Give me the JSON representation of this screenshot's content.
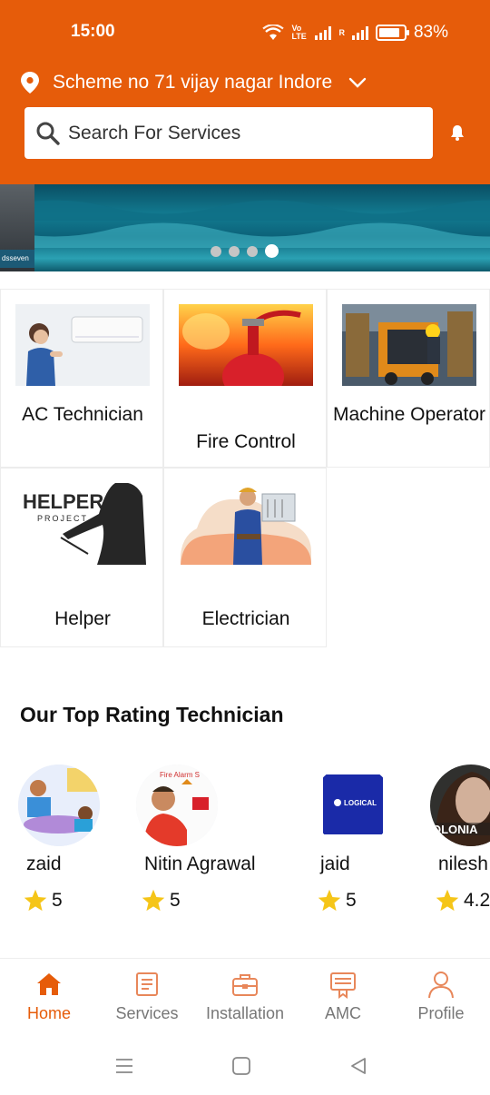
{
  "status_bar": {
    "time": "15:00",
    "battery": "83%",
    "battery_level": 0.83,
    "volte": "Vo LTE",
    "net": "R"
  },
  "header": {
    "location": "Scheme no 71 vijay nagar Indore",
    "search_placeholder": "Search For Services",
    "accent_color": "#E65C0A"
  },
  "banner": {
    "side_label": "dsseven",
    "slide_count": 4,
    "active_slide": 4
  },
  "services": [
    {
      "label": "AC Technician"
    },
    {
      "label": "Fire Control"
    },
    {
      "label": "Machine Operator"
    },
    {
      "label": "Helper"
    },
    {
      "label": "Electrician"
    }
  ],
  "helper_logo_text": {
    "line1": "HELPER",
    "line2": "PROJECT"
  },
  "top_rating": {
    "title": "Our Top Rating Technician",
    "technicians": [
      {
        "name": "zaid",
        "rating": "5"
      },
      {
        "name": "Nitin Agrawal",
        "rating": "5",
        "avatar_text": "Fire Alarm S"
      },
      {
        "name": "jaid",
        "rating": "5",
        "avatar_text": "LOGICAL"
      },
      {
        "name": "nilesh",
        "rating": "4.2",
        "avatar_text": "OLONIA"
      }
    ]
  },
  "bottom_nav": [
    {
      "label": "Home",
      "icon": "home-icon",
      "active": true
    },
    {
      "label": "Services",
      "icon": "list-icon",
      "active": false
    },
    {
      "label": "Installation",
      "icon": "toolbox-icon",
      "active": false
    },
    {
      "label": "AMC",
      "icon": "document-icon",
      "active": false
    },
    {
      "label": "Profile",
      "icon": "person-icon",
      "active": false
    }
  ]
}
